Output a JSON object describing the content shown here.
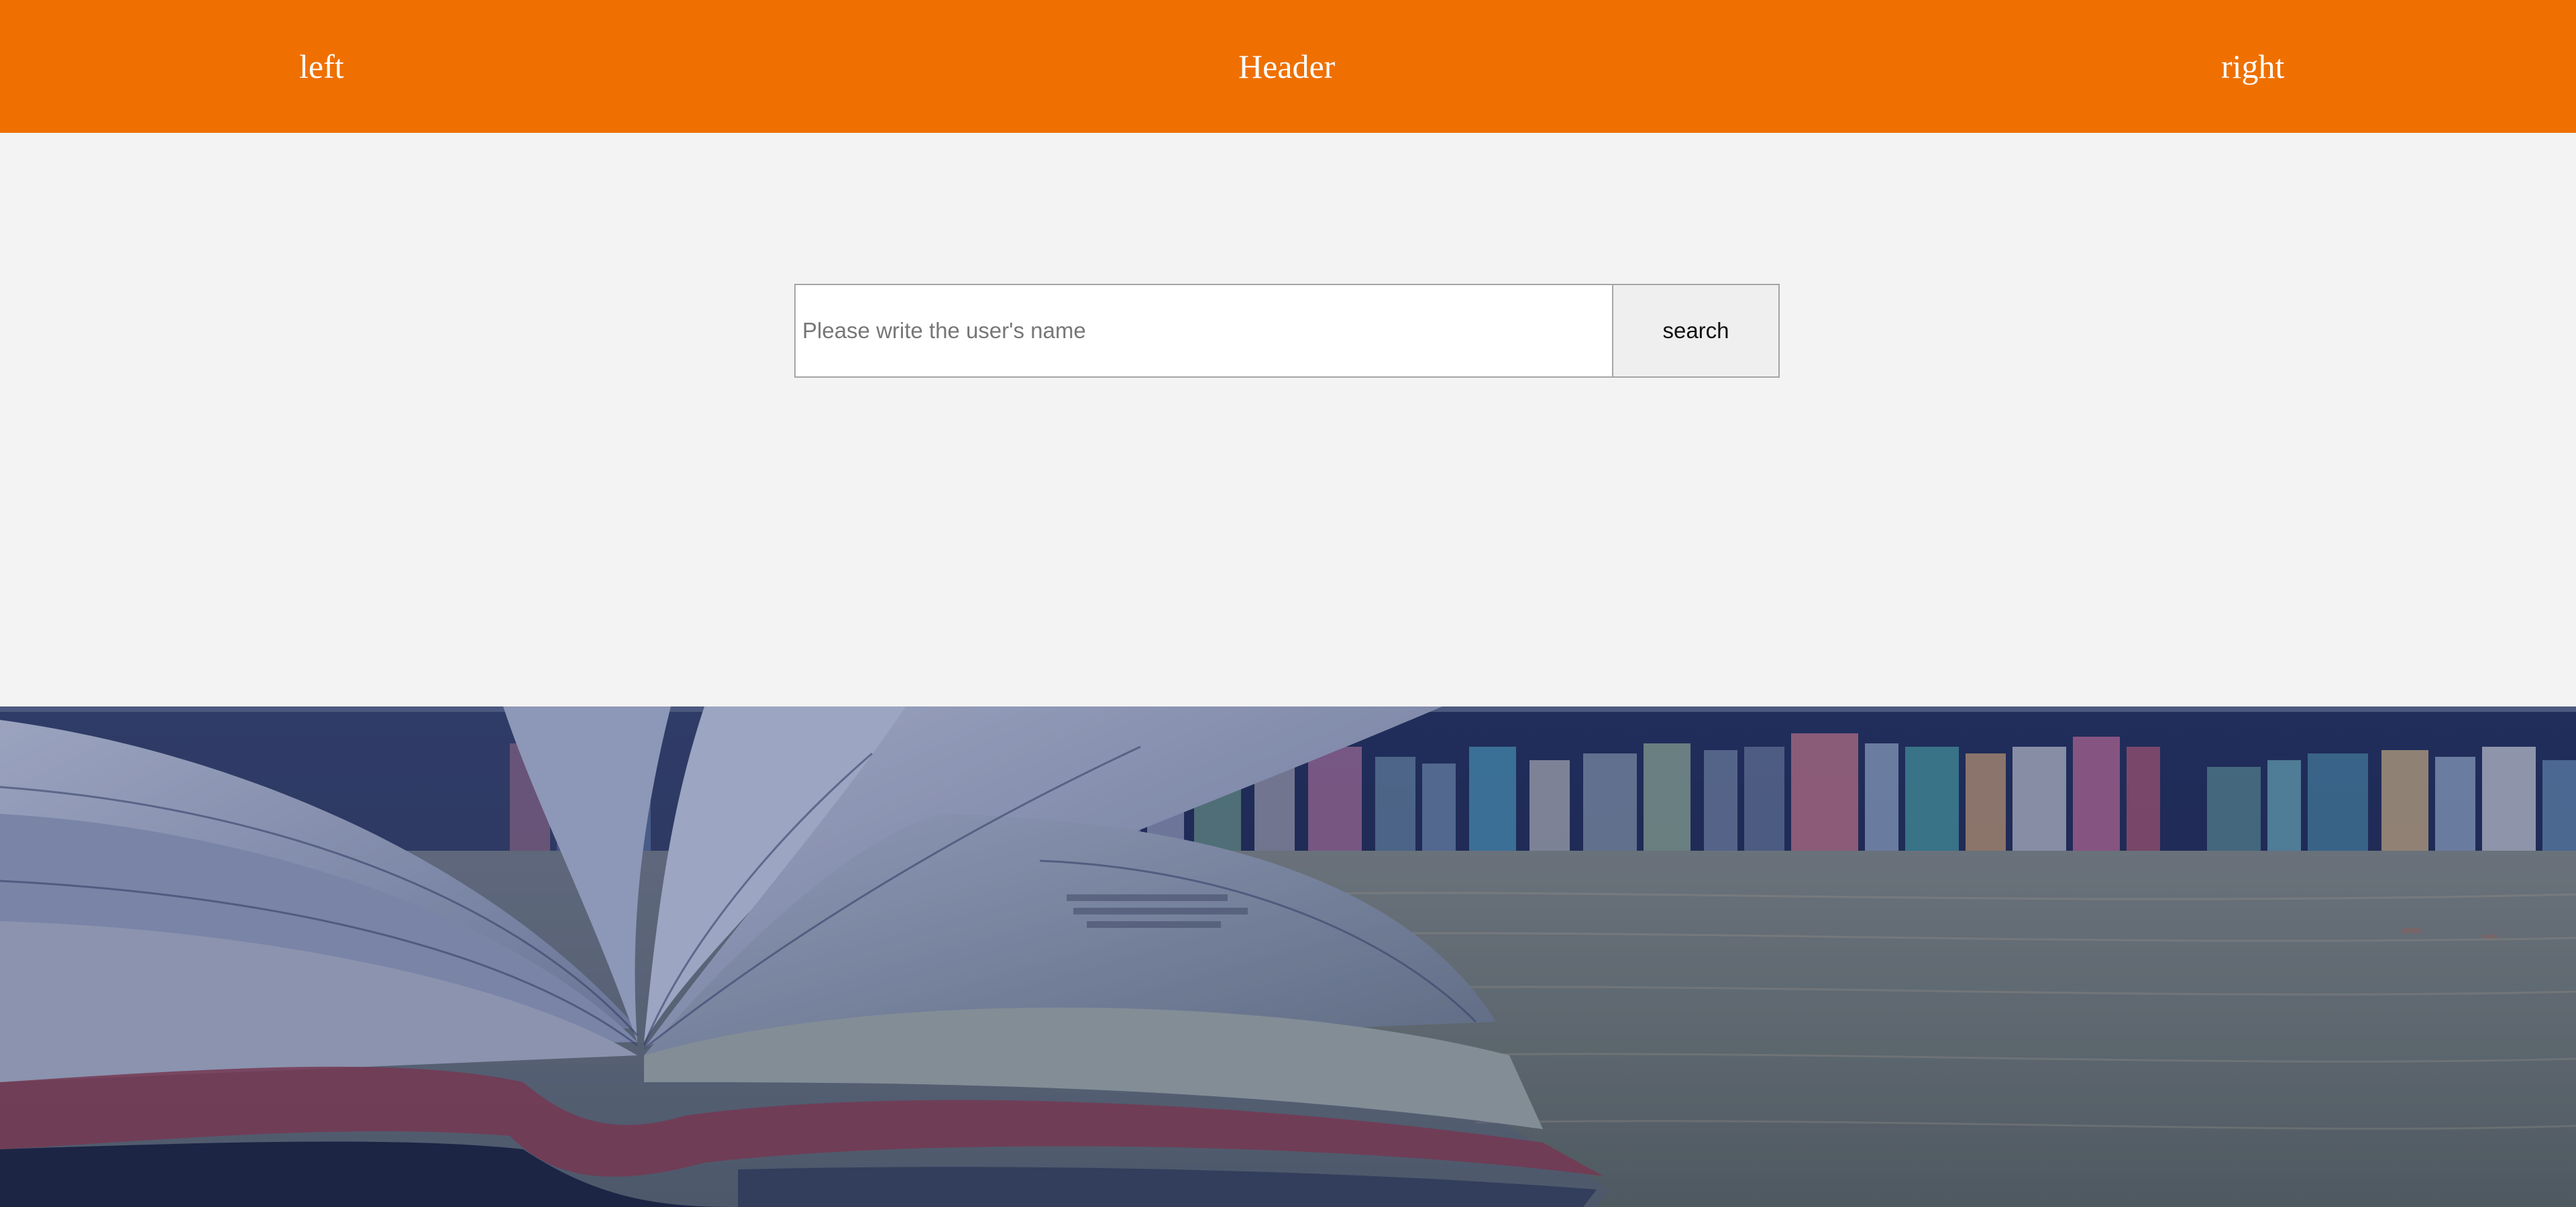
{
  "header": {
    "left_label": "left",
    "center_label": "Header",
    "right_label": "right",
    "background_color": "#ef7000"
  },
  "search": {
    "placeholder": "Please write the user's name",
    "value": "",
    "button_label": "search"
  },
  "hero": {
    "icon": "open-book-on-desk-image"
  }
}
